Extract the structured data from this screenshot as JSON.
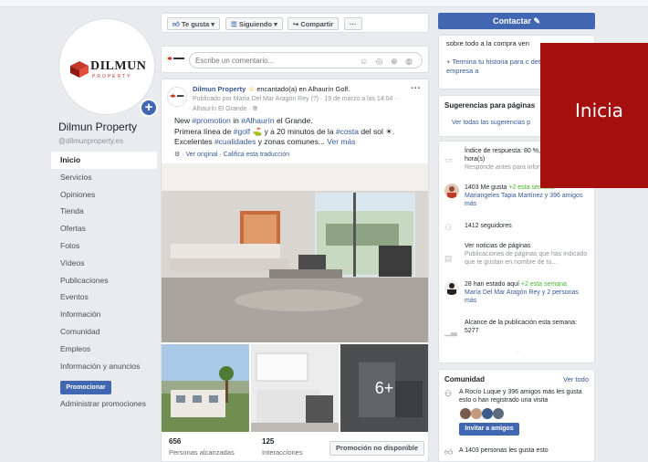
{
  "page": {
    "name": "Dilmun Property",
    "handle": "@dilmunproperty.es",
    "logo_text": "DILMUN",
    "logo_subtext": "PROPERTY"
  },
  "sidebar": {
    "items": [
      {
        "label": "Inicio",
        "active": true
      },
      {
        "label": "Servicios"
      },
      {
        "label": "Opiniones"
      },
      {
        "label": "Tienda"
      },
      {
        "label": "Ofertas"
      },
      {
        "label": "Fotos"
      },
      {
        "label": "Vídeos"
      },
      {
        "label": "Publicaciones"
      },
      {
        "label": "Eventos"
      },
      {
        "label": "Información"
      },
      {
        "label": "Comunidad"
      },
      {
        "label": "Empleos"
      },
      {
        "label": "Información y anuncios"
      }
    ],
    "promote_label": "Promocionar",
    "admin_promotions_label": "Administrar promociones"
  },
  "actions": {
    "like": "Te gusta ▾",
    "follow": "Siguiendo ▾",
    "share": "Compartir",
    "more": "···"
  },
  "comment": {
    "placeholder": "Escribe un comentario...",
    "icons": "☺ ◎ ⊕ ◍"
  },
  "post": {
    "author": "Dilmun Property",
    "activity": "encantado(a) en Alhaurín Golf.",
    "byline": "Publicado por María Del Mar Aragón Rey (?) · 19 de marzo a las 14:04 ·",
    "location": "Alhaurín El Grande · ",
    "line1_pre": "New ",
    "line1_tag1": "#promotion",
    "line1_mid": " in ",
    "line1_tag2": "#Alhaurín",
    "line1_post": " el Grande.",
    "line2_pre": "Primera línea de ",
    "line2_tag1": "#golf",
    "line2_mid": " ⛳ y a 20 minutos de la ",
    "line2_tag2": "#costa",
    "line2_post": " del sol ☀.",
    "line3_pre": "Excelentes ",
    "line3_tag1": "#cualidades",
    "line3_mid": " y zonas comunes... ",
    "line3_more": "Ver más",
    "view_original": "Ver original",
    "rate_translation": "Califica esta traducción",
    "more_photos": "6+",
    "reach_value": "656",
    "reach_label": "Personas alcanzadas",
    "interactions_value": "125",
    "interactions_label": "Interacciones",
    "promo_unavailable": "Promoción no disponible"
  },
  "right": {
    "contact_label": "Contactar ✎",
    "about_text": "sobre todo a la compra ven",
    "finish_story": "+ Termina tu historia para c detalles sobre tu empresa a",
    "suggestions_title": "Sugerencias para páginas",
    "suggestions_link": "Ver todas las sugerencias p",
    "response_rate": "Índice de respuesta: 80 %, respuesta: 4 hora(s)",
    "response_sub": "Responde antes para inform",
    "likes_text": "1403 Me gusta",
    "likes_week": "+2 esta semana",
    "likes_friends": "Mariangeles Tapia Martínez y 396 amigos más",
    "followers": "1412 seguidores",
    "page_news": "Ver noticias de páginas",
    "page_news_sub": "Publicaciones de páginas que has indicado que te gustan en nombre de tu...",
    "checkins": "28 han estado aquí",
    "checkins_week": "+2 esta semana",
    "checkins_friends": "María Del Mar Aragón Rey y 2 personas más",
    "reach_week": "Alcance de la publicación esta semana: 5277",
    "community_title": "Comunidad",
    "community_link": "Ver todo",
    "community_text": "A Rocío Luque y 396 amigos más les gusta esto o han registrado una visita",
    "invite_label": "Invitar a amigos",
    "community_likes": "A 1403 personas les gusta esto"
  },
  "banner": {
    "text": "Inicia"
  },
  "colors": {
    "accent": "#4267b2",
    "banner": "#a5100f",
    "background": "#e9ebee"
  }
}
